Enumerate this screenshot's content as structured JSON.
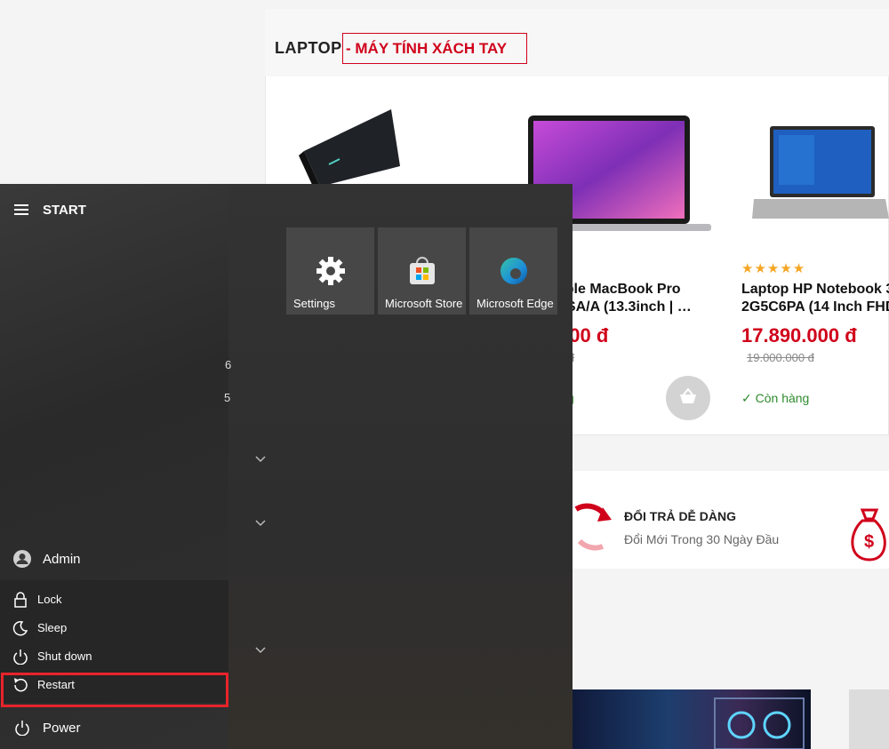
{
  "web": {
    "category_title": "LAPTOP",
    "category_subtitle": "- MÁY TÍNH XÁCH TAY",
    "products": [
      {
        "name_line1": "ople MacBook Pro",
        "name_line2": "3SA/A (13.3inch | …",
        "price": "000 đ",
        "old_price": "0 đ",
        "stock": "g"
      },
      {
        "name_line1": "Laptop HP Notebook 3",
        "name_line2": "2G5C6PA (14 Inch FHD",
        "rating": "★★★★★",
        "price": "17.890.000 đ",
        "old_price": "19.000.000 đ",
        "stock": "✓ Còn hàng"
      }
    ],
    "feature": {
      "title": "ĐỔI TRẢ DỄ DÀNG",
      "desc": "Đổi Mới Trong 30 Ngày Đầu"
    }
  },
  "start_menu": {
    "header": "START",
    "tiles": [
      {
        "label": "Settings",
        "icon": "gear-icon"
      },
      {
        "label": "Microsoft Store",
        "icon": "store-icon"
      },
      {
        "label": "Microsoft Edge",
        "icon": "edge-icon"
      }
    ],
    "stray_text": [
      "6",
      "5"
    ],
    "user": "Admin",
    "power_options": [
      "Lock",
      "Sleep",
      "Shut down",
      "Restart"
    ],
    "power_label": "Power",
    "highlight_color": "#e8232b"
  }
}
